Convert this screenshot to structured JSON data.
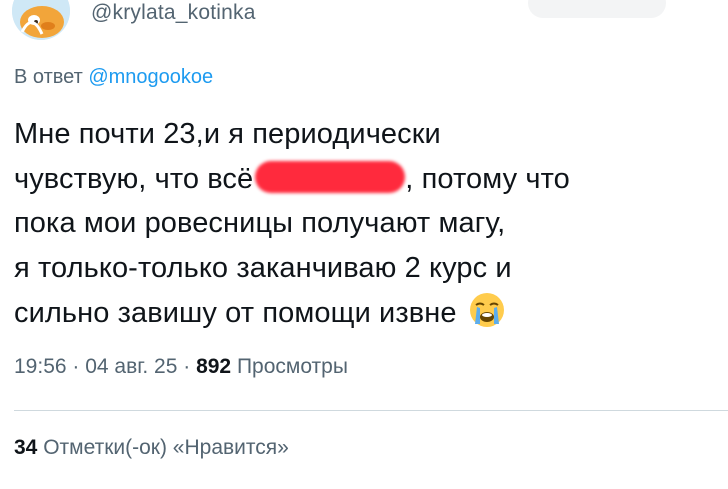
{
  "tweet": {
    "handle": "@krylata_kotinka",
    "reply_prefix": "В ответ",
    "reply_to": "@mnogookoe",
    "text_lines": [
      "Мне почти 23,и я периодически",
      "чувствую, что всё",
      ", потому что",
      "пока мои ровесницы получают магу,",
      "я только-только заканчиваю 2 курс и",
      "сильно завишу от помощи извне"
    ],
    "emoji": "loudly-crying-face-emoji",
    "time": "19:56",
    "date": "04 авг. 25",
    "views_count": "892",
    "views_label": "Просмотры",
    "likes_count": "34",
    "likes_label": "Отметки(-ок) «Нравится»"
  },
  "colors": {
    "text": "#0f1419",
    "secondary": "#536471",
    "link": "#1d9bf0",
    "redaction": "#ff2a3d"
  }
}
